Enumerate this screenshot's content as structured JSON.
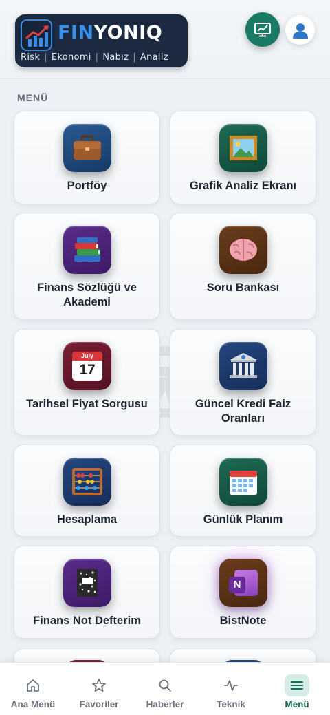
{
  "header": {
    "logo_prefix": "FIN",
    "logo_suffix": "YONIQ",
    "tagline": [
      "Risk",
      "Ekonomi",
      "Nabız",
      "Analiz"
    ],
    "tagline_separator": "|",
    "chart_button_icon": "chart-screen-icon",
    "profile_icon": "user-icon"
  },
  "menu": {
    "section_label": "MENÜ",
    "items": [
      {
        "label": "Portföy",
        "icon": "briefcase-icon"
      },
      {
        "label": "Grafik Analiz Ekranı",
        "icon": "framed-picture-icon"
      },
      {
        "label": "Finans Sözlüğü ve Akademi",
        "icon": "books-icon"
      },
      {
        "label": "Soru Bankası",
        "icon": "brain-icon"
      },
      {
        "label": "Tarihsel Fiyat Sorgusu",
        "icon": "calendar-icon",
        "calendar_month": "July",
        "calendar_day": "17"
      },
      {
        "label": "Güncel Kredi Faiz Oranları",
        "icon": "bank-icon"
      },
      {
        "label": "Hesaplama",
        "icon": "abacus-icon"
      },
      {
        "label": "Günlük Planım",
        "icon": "planner-icon"
      },
      {
        "label": "Finans Not Defterim",
        "icon": "notebook-icon"
      },
      {
        "label": "BistNote",
        "icon": "onenote-icon",
        "badge_letter": "N"
      }
    ]
  },
  "bottom_nav": {
    "items": [
      {
        "label": "Ana Menü",
        "icon": "home-icon",
        "active": false
      },
      {
        "label": "Favoriler",
        "icon": "star-icon",
        "active": false
      },
      {
        "label": "Haberler",
        "icon": "search-icon",
        "active": false
      },
      {
        "label": "Teknik",
        "icon": "pulse-icon",
        "active": false
      },
      {
        "label": "Menü",
        "icon": "hamburger-menu-icon",
        "active": true
      }
    ]
  },
  "colors": {
    "logo_bg": "#1b2a40",
    "logo_accent": "#3a8fe8",
    "primary_green": "#1a7a66",
    "active_nav_bg": "#d6ece6",
    "page_bg": "#edf1f5"
  }
}
